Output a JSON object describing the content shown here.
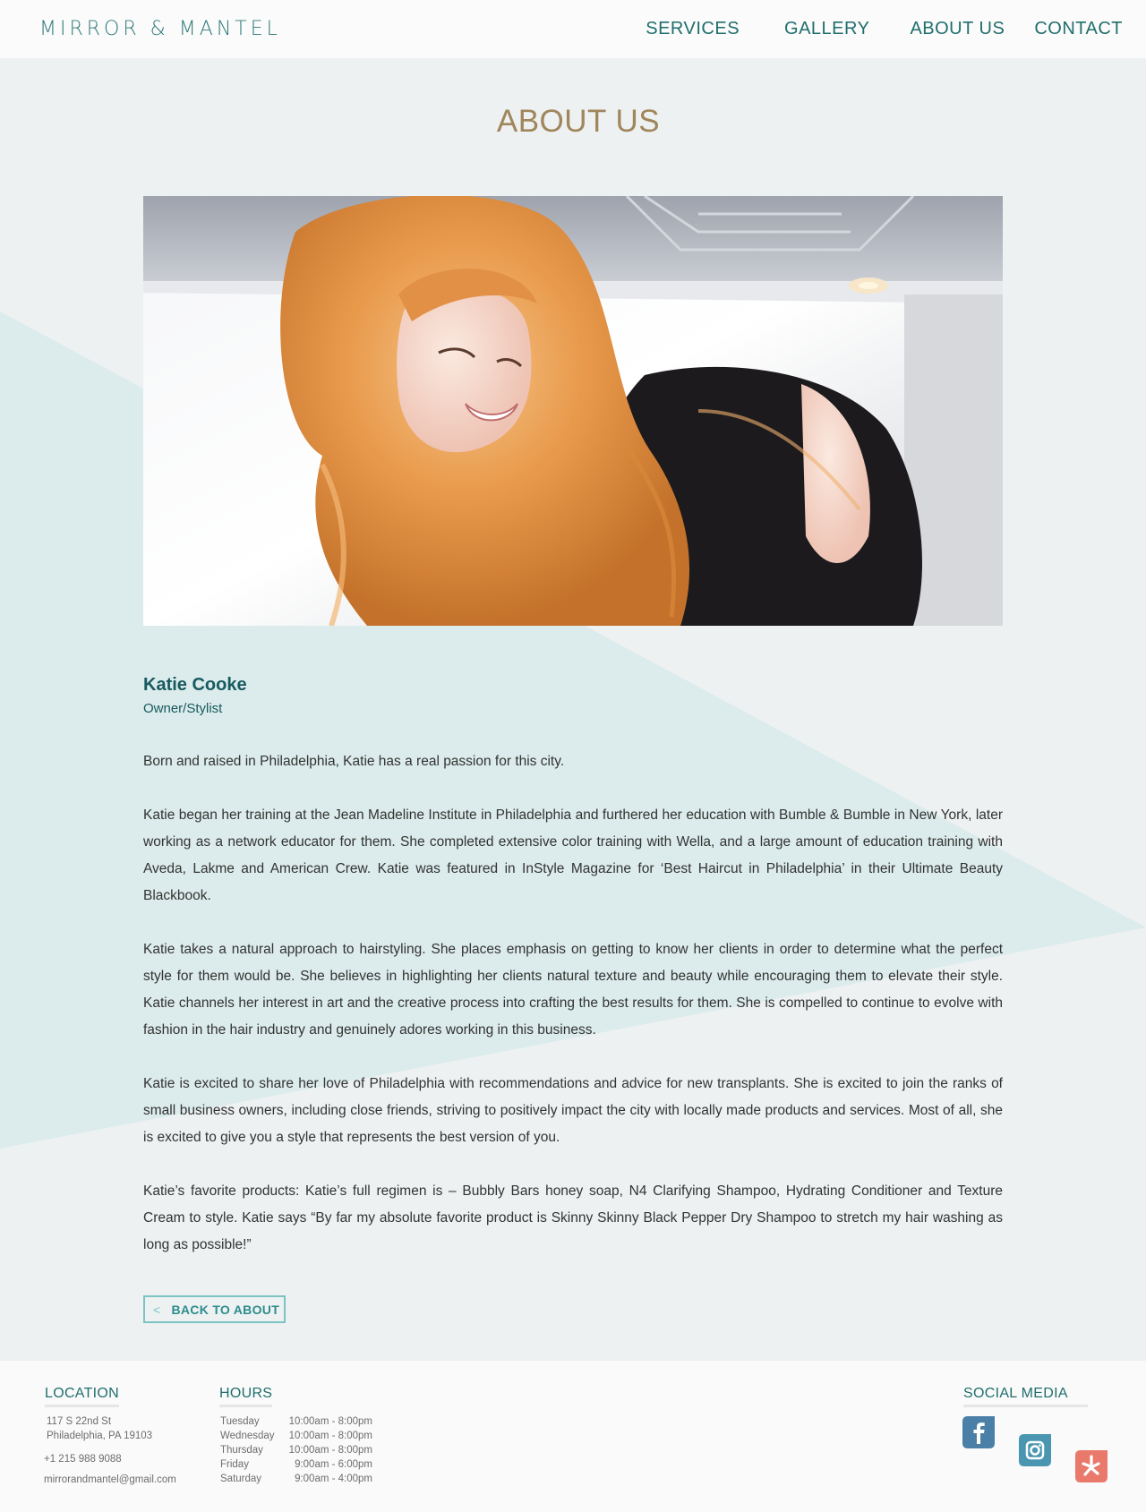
{
  "header": {
    "logo": "MIRROR & MANTEL",
    "nav": [
      "SERVICES",
      "GALLERY",
      "ABOUT US",
      "CONTACT"
    ]
  },
  "main": {
    "title": "ABOUT US",
    "name": "Katie Cooke",
    "role": "Owner/Stylist",
    "paragraphs": [
      "Born and raised in Philadelphia, Katie has a real passion for this city.",
      "Katie began her training at the Jean Madeline Institute in Philadelphia and furthered her education with Bumble & Bumble in New York, later working as a network educator for them. She completed extensive color training with Wella, and a large amount of education training with Aveda, Lakme and American Crew. Katie was featured in InStyle Magazine for ‘Best Haircut in Philadelphia’ in their Ultimate Beauty Blackbook.",
      "Katie takes a natural approach to hairstyling. She places emphasis on getting to know her clients in order to determine what the perfect style for them would be. She believes in highlighting her clients natural texture and beauty while encouraging them to elevate their style. Katie channels her interest in art and the creative process into crafting the best results for them. She is compelled to continue to evolve with fashion in the hair industry and genuinely adores working in this business.",
      "Katie is excited to share her love of Philadelphia with recommendations and advice for new transplants. She is excited to join the ranks of small business owners, including close friends, striving to positively impact the city with locally made products and services. Most of all, she is excited to give you a style that represents the best version of you.",
      "Katie’s favorite products: Katie’s full regimen is – Bubbly Bars honey soap, N4 Clarifying Shampoo, Hydrating Conditioner and Texture Cream to style. Katie says “By far my absolute favorite product is Skinny Skinny Black Pepper Dry Shampoo to stretch my hair washing as long as possible!”"
    ],
    "back_chevron": "<",
    "back_label": "BACK TO ABOUT"
  },
  "footer": {
    "location": {
      "heading": "LOCATION",
      "street": "117 S 22nd St",
      "city": "Philadelphia, PA 19103",
      "phone": "+1 215 988 9088",
      "email": "mirrorandmantel@gmail.com"
    },
    "hours": {
      "heading": "HOURS",
      "rows": [
        {
          "day": "Tuesday",
          "time": "10:00am - 8:00pm"
        },
        {
          "day": "Wednesday",
          "time": "10:00am - 8:00pm"
        },
        {
          "day": "Thursday",
          "time": "10:00am - 8:00pm"
        },
        {
          "day": "Friday",
          "time": "9:00am - 6:00pm"
        },
        {
          "day": "Saturday",
          "time": "9:00am - 4:00pm"
        }
      ]
    },
    "social": {
      "heading": "SOCIAL MEDIA",
      "icons": [
        "facebook-icon",
        "instagram-icon",
        "yelp-icon"
      ]
    }
  },
  "colors": {
    "brand_teal": "#1f6e6c",
    "title_gold": "#a1865c",
    "bg_triangle": "#dcebeb",
    "facebook": "#4a7fa8",
    "instagram": "#4a96b0",
    "yelp": "#e8796b"
  }
}
